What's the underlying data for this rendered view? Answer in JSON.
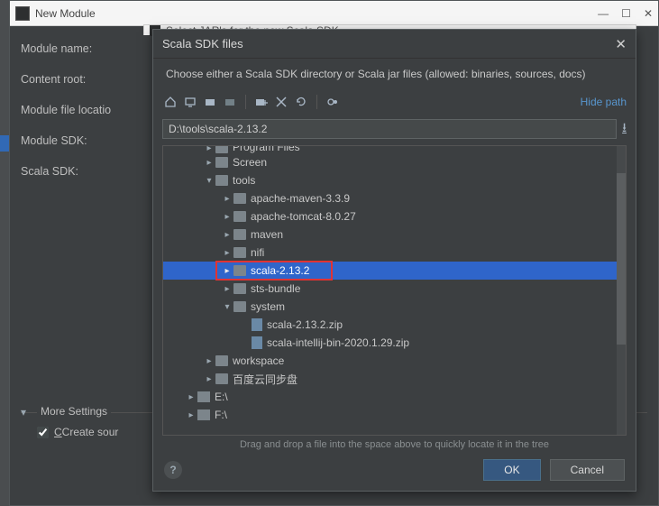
{
  "newModule": {
    "title": "New Module",
    "labels": {
      "moduleName": "Module name:",
      "contentRoot": "Content root:",
      "moduleFileLocation": "Module file locatio",
      "moduleSdk": "Module SDK:",
      "scalaSdk": "Scala SDK:"
    },
    "moreSettings": "More Settings",
    "createSource": "Create sour"
  },
  "sdkHiddenTitle": "Select JAR's for the new Scala SDK",
  "sdk": {
    "title": "Scala SDK files",
    "description": "Choose either a Scala SDK directory or Scala jar files (allowed: binaries, sources, docs)",
    "hidePath": "Hide path",
    "path": "D:\\tools\\scala-2.13.2",
    "hint": "Drag and drop a file into the space above to quickly locate it in the tree",
    "ok": "OK",
    "cancel": "Cancel",
    "tree": [
      {
        "depth": 1,
        "icon": "folder",
        "expand": "right",
        "label": "Program Files",
        "cut": true
      },
      {
        "depth": 1,
        "icon": "folder",
        "expand": "right",
        "label": "Screen"
      },
      {
        "depth": 1,
        "icon": "folder",
        "expand": "down",
        "label": "tools"
      },
      {
        "depth": 2,
        "icon": "folder",
        "expand": "right",
        "label": "apache-maven-3.3.9"
      },
      {
        "depth": 2,
        "icon": "folder",
        "expand": "right",
        "label": "apache-tomcat-8.0.27"
      },
      {
        "depth": 2,
        "icon": "folder",
        "expand": "right",
        "label": "maven"
      },
      {
        "depth": 2,
        "icon": "folder",
        "expand": "right",
        "label": "nifi"
      },
      {
        "depth": 2,
        "icon": "folder",
        "expand": "right",
        "label": "scala-2.13.2",
        "selected": true,
        "redbox": true
      },
      {
        "depth": 2,
        "icon": "folder",
        "expand": "right",
        "label": "sts-bundle"
      },
      {
        "depth": 2,
        "icon": "folder",
        "expand": "down",
        "label": "system"
      },
      {
        "depth": 3,
        "icon": "zip",
        "expand": "",
        "label": "scala-2.13.2.zip"
      },
      {
        "depth": 3,
        "icon": "zip",
        "expand": "",
        "label": "scala-intellij-bin-2020.1.29.zip"
      },
      {
        "depth": 1,
        "icon": "folder",
        "expand": "right",
        "label": "workspace"
      },
      {
        "depth": 1,
        "icon": "folder",
        "expand": "right",
        "label": "百度云同步盘"
      },
      {
        "depth": 0,
        "icon": "drive",
        "expand": "right",
        "label": "E:\\"
      },
      {
        "depth": 0,
        "icon": "drive",
        "expand": "right",
        "label": "F:\\"
      }
    ]
  }
}
